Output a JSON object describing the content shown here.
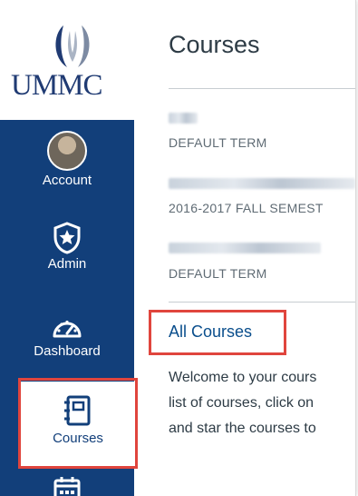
{
  "sidebar": {
    "logo_text": "UMMC",
    "items": [
      {
        "label": "Account",
        "icon": "user-avatar"
      },
      {
        "label": "Admin",
        "icon": "shield-star-icon"
      },
      {
        "label": "Dashboard",
        "icon": "speedometer-icon"
      },
      {
        "label": "Courses",
        "icon": "book-icon",
        "active": true
      },
      {
        "label": "",
        "icon": "calendar-icon"
      }
    ]
  },
  "main": {
    "title": "Courses",
    "courses": [
      {
        "term": "DEFAULT TERM"
      },
      {
        "term": "2016-2017 FALL SEMEST"
      },
      {
        "term": "DEFAULT TERM"
      }
    ],
    "all_courses_link": "All Courses",
    "welcome_lines": [
      "Welcome to your cours",
      "list of courses, click on",
      "and star the courses to"
    ]
  },
  "colors": {
    "nav_background": "#123f7a",
    "highlight": "#e0453d",
    "link": "#0a4e8c"
  }
}
